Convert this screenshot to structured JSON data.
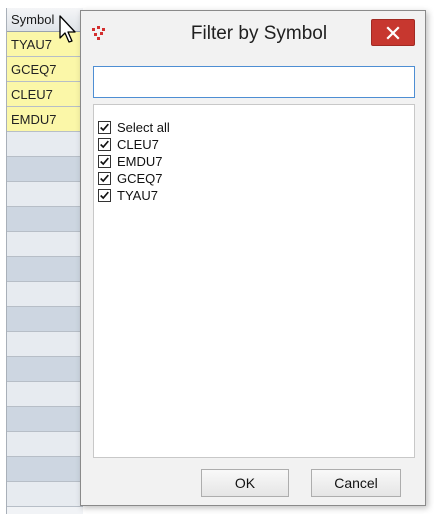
{
  "grid": {
    "header": "Symbol",
    "rows": [
      "TYAU7",
      "GCEQ7",
      "CLEU7",
      "EMDU7"
    ],
    "empty_row_count": 15
  },
  "dialog": {
    "title": "Filter by Symbol",
    "filter_value": "",
    "items": [
      {
        "label": "Select all",
        "checked": true
      },
      {
        "label": "CLEU7",
        "checked": true
      },
      {
        "label": "EMDU7",
        "checked": true
      },
      {
        "label": "GCEQ7",
        "checked": true
      },
      {
        "label": "TYAU7",
        "checked": true
      }
    ],
    "ok_label": "OK",
    "cancel_label": "Cancel"
  },
  "colors": {
    "highlight_row": "#fbf7a8",
    "close_button": "#c7372f",
    "input_border": "#4e8ed3"
  },
  "icons": {
    "app": "app-logo-icon",
    "close": "close-icon",
    "check": "checkmark-icon",
    "cursor": "mouse-pointer-icon"
  }
}
